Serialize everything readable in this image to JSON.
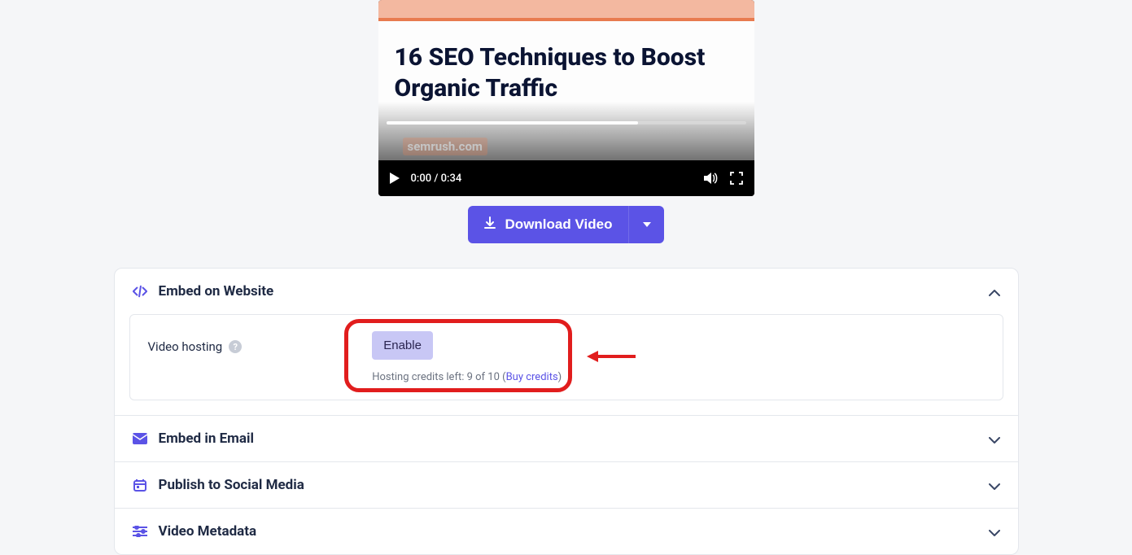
{
  "video": {
    "title": "16 SEO Techniques to Boost Organic Traffic",
    "watermark": "semrush.com",
    "time": "0:00 / 0:34"
  },
  "download": {
    "label": "Download Video"
  },
  "accordions": {
    "embed_website": {
      "title": "Embed on Website"
    },
    "embed_email": {
      "title": "Embed in Email"
    },
    "social": {
      "title": "Publish to Social Media"
    },
    "metadata": {
      "title": "Video Metadata"
    }
  },
  "hosting": {
    "label": "Video hosting",
    "enable": "Enable",
    "credits_prefix": "Hosting credits left: 9 of 10 (",
    "buy": "Buy credits",
    "credits_suffix": ")"
  }
}
